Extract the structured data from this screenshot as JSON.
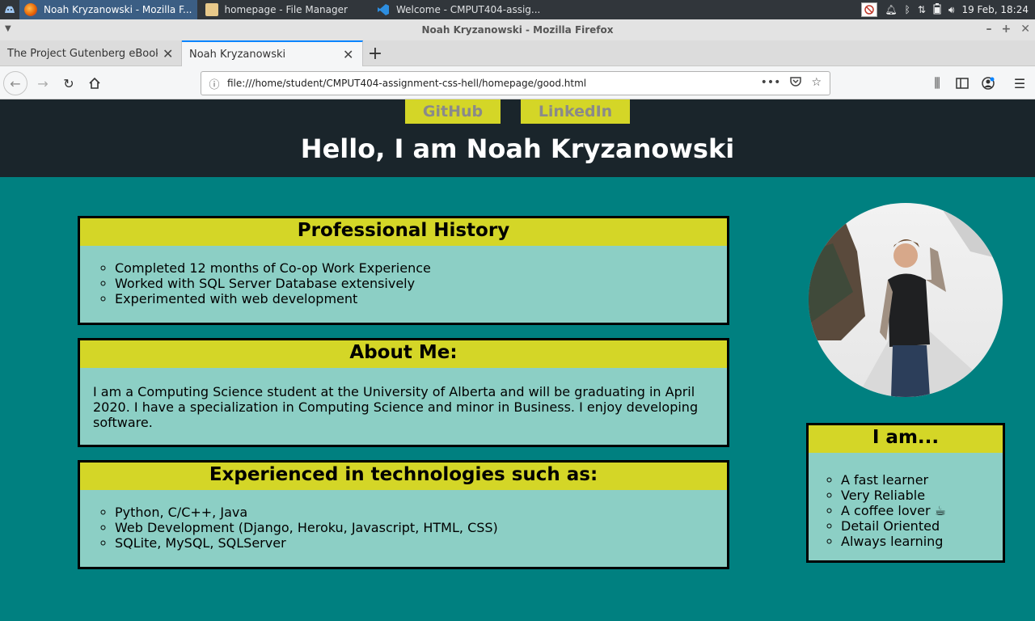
{
  "taskbar": {
    "tasks": [
      {
        "label": "Noah Kryzanowski - Mozilla F..."
      },
      {
        "label": "homepage - File Manager"
      },
      {
        "label": "Welcome - CMPUT404-assig..."
      }
    ],
    "clock": "19 Feb, 18:24"
  },
  "window": {
    "title": "Noah Kryzanowski - Mozilla Firefox"
  },
  "tabs": [
    {
      "label": "The Project Gutenberg eBook of Ja"
    },
    {
      "label": "Noah Kryzanowski"
    }
  ],
  "urlbar": {
    "url": "file:///home/student/CMPUT404-assignment-css-hell/homepage/good.html"
  },
  "page": {
    "links": {
      "github": "GitHub",
      "linkedin": "LinkedIn"
    },
    "heading": "Hello, I am Noah Kryzanowski",
    "professional": {
      "title": "Professional History",
      "items": [
        "Completed 12 months of Co-op Work Experience",
        "Worked with SQL Server Database extensively",
        "Experimented with web development"
      ]
    },
    "about": {
      "title": "About Me:",
      "text": "I am a Computing Science student at the University of Alberta and will be graduating in April 2020. I have a specialization in Computing Science and minor in Business. I enjoy developing software."
    },
    "tech": {
      "title": "Experienced in technologies such as:",
      "items": [
        "Python, C/C++, Java",
        "Web Development (Django, Heroku, Javascript, HTML, CSS)",
        "SQLite, MySQL, SQLServer"
      ]
    },
    "iam": {
      "title": "I am...",
      "items": [
        "A fast learner",
        "Very Reliable",
        "A coffee lover ☕",
        "Detail Oriented",
        "Always learning"
      ]
    }
  },
  "colors": {
    "page_bg": "#008080",
    "header_bg": "#1a252b",
    "accent_yellow": "#d4d627",
    "card_bg": "#8ccfc5"
  }
}
